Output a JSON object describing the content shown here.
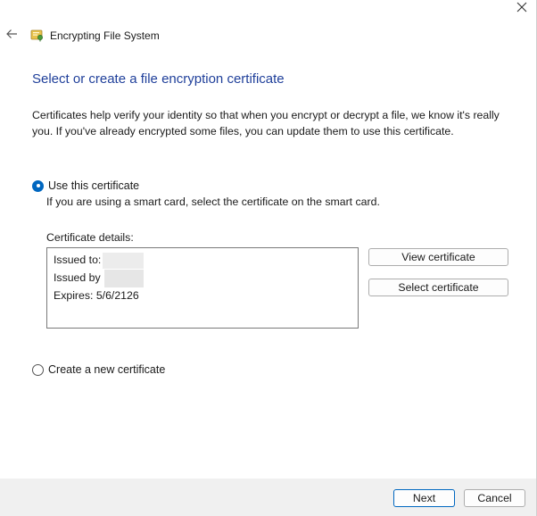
{
  "window": {
    "title": "Encrypting File System",
    "close_glyph": "✕"
  },
  "page": {
    "heading": "Select or create a file encryption certificate",
    "description": "Certificates help verify your identity so that when you encrypt or decrypt a file, we know it's really you. If you've already encrypted some files, you can update them to use this certificate."
  },
  "options": {
    "use_existing": {
      "label": "Use this certificate",
      "selected": true,
      "hint": "If you are using a smart card, select the certificate on the smart card."
    },
    "create_new": {
      "label": "Create a new certificate",
      "selected": false
    }
  },
  "certificate": {
    "details_label": "Certificate details:",
    "issued_to": "Issued to:",
    "issued_by": "Issued by",
    "expires": "Expires: 5/6/2126",
    "view_button": "View certificate",
    "select_button": "Select certificate"
  },
  "footer": {
    "next_button": "Next",
    "cancel_button": "Cancel"
  },
  "colors": {
    "heading": "#1f3f9a",
    "accent": "#0067c0",
    "footer_bg": "#f0f0f0"
  },
  "icons": {
    "back": "back-arrow-icon",
    "app": "certificate-key-icon",
    "close": "close-icon"
  }
}
